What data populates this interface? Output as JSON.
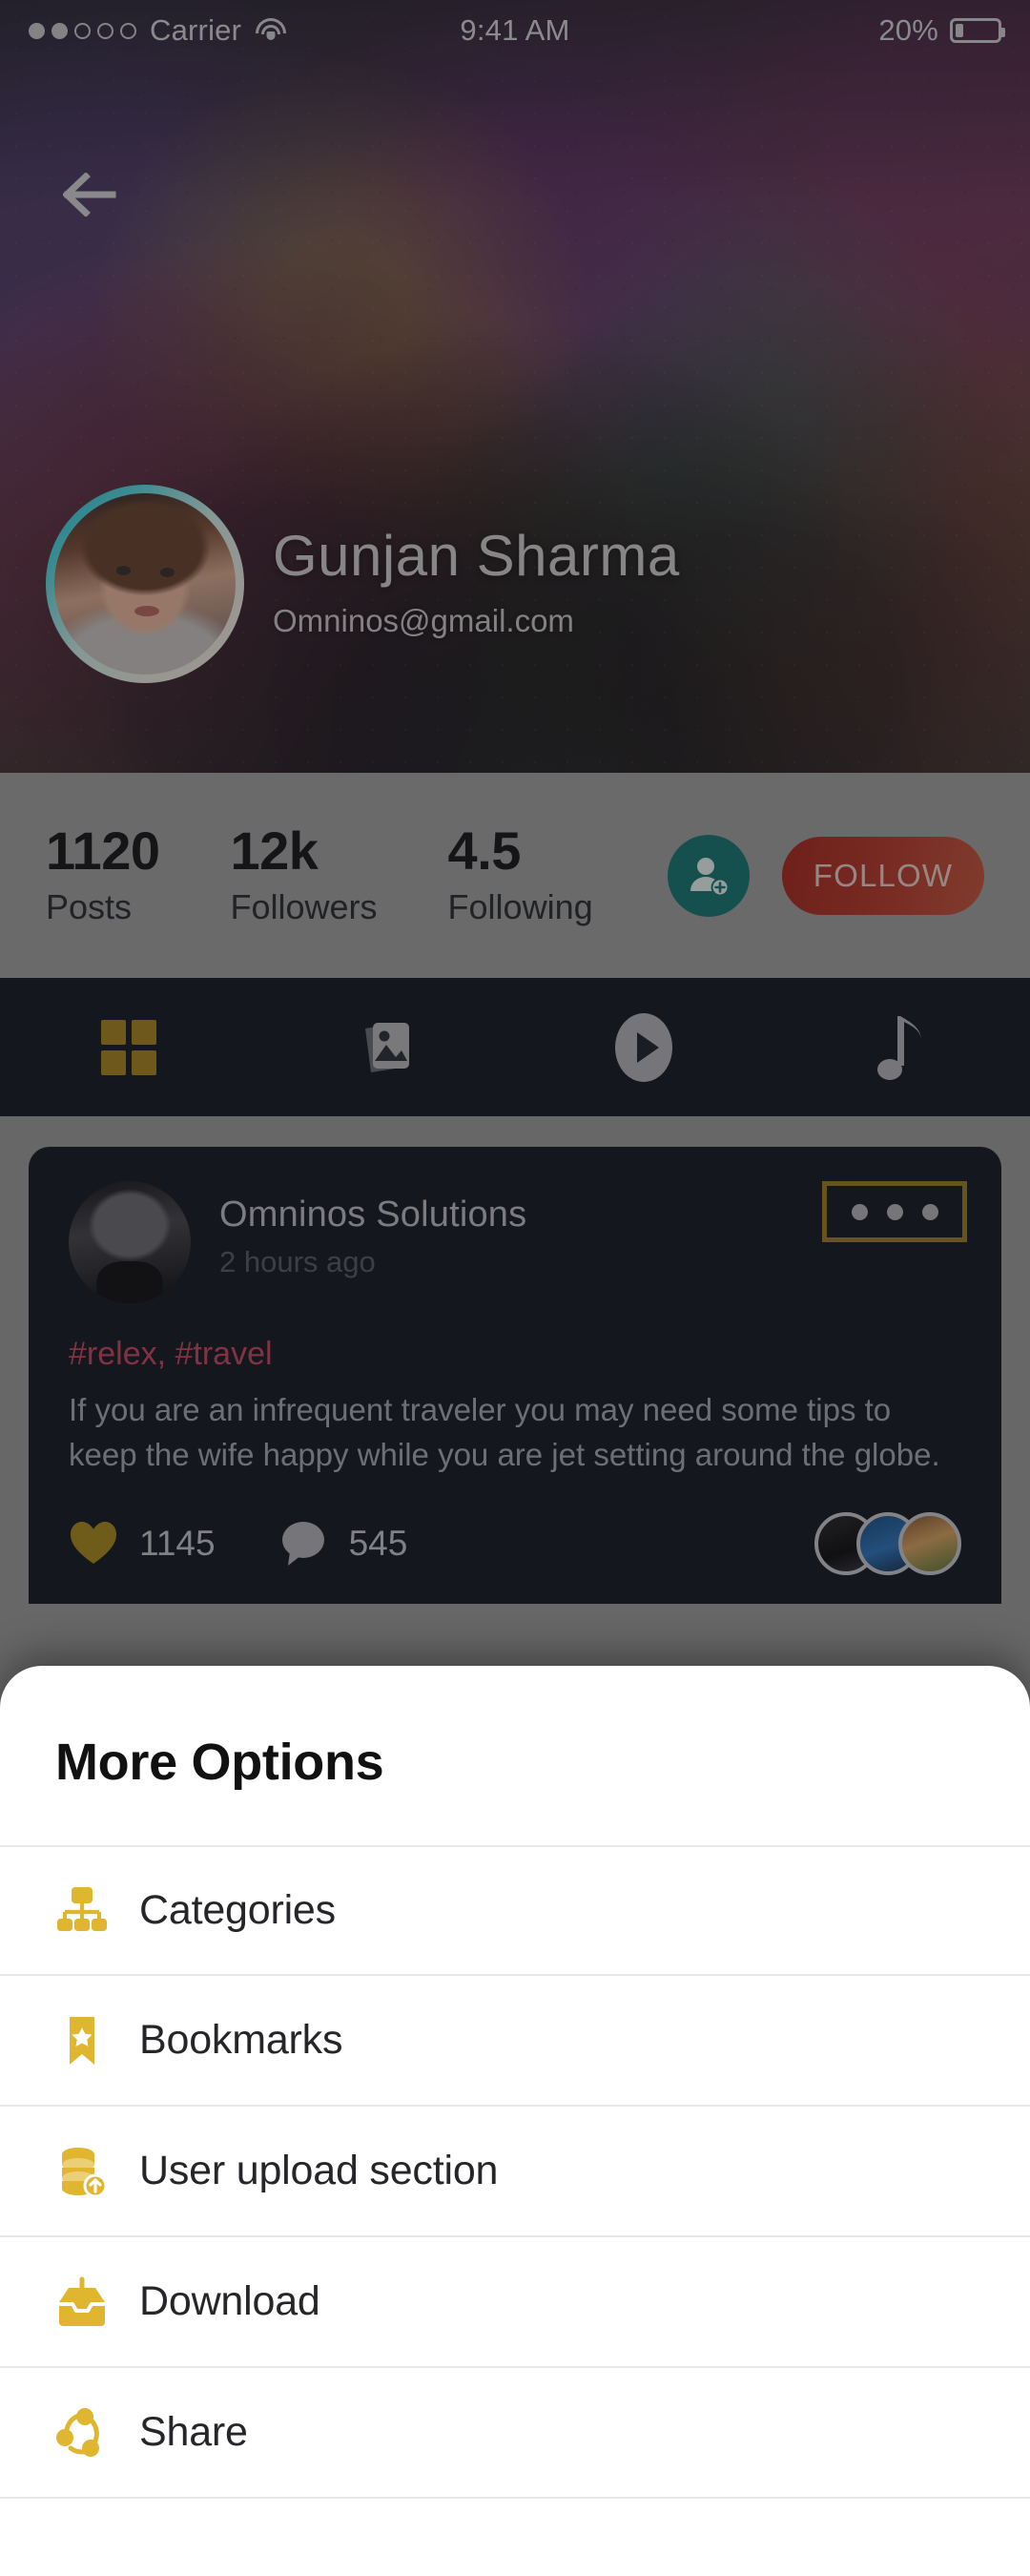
{
  "status_bar": {
    "carrier": "Carrier",
    "signal_dots_filled": 2,
    "signal_dots_total": 5,
    "wifi_icon": "wifi-icon",
    "time": "9:41 AM",
    "battery_percent": "20%",
    "battery_level": 20
  },
  "header": {
    "back_icon": "arrow-left-icon",
    "name": "Gunjan Sharma",
    "email": "Omninos@gmail.com",
    "avatar": "profile-avatar",
    "avatar_ring_color": "#35cdd8"
  },
  "stats": {
    "items": [
      {
        "value": "1120",
        "label": "Posts"
      },
      {
        "value": "12k",
        "label": "Followers"
      },
      {
        "value": "4.5",
        "label": "Following"
      }
    ],
    "add_user_icon": "add-user-icon",
    "add_user_color": "#177771",
    "follow_label": "FOLLOW",
    "follow_color": "#b03425",
    "background": "#a0a0a0"
  },
  "tabs": {
    "active_index": 0,
    "active_color": "#a8841f",
    "inactive_color": "#b4b4b8",
    "background": "#161a23",
    "items": [
      {
        "icon": "grid-icon",
        "name": "tab-grid"
      },
      {
        "icon": "photos-icon",
        "name": "tab-photos"
      },
      {
        "icon": "play-circle-icon",
        "name": "tab-videos"
      },
      {
        "icon": "music-note-icon",
        "name": "tab-music"
      }
    ]
  },
  "post": {
    "author": "Omninos Solutions",
    "timestamp": "2 hours ago",
    "avatar": "post-author-avatar",
    "more_icon": "more-horizontal-icon",
    "more_highlight_color": "#9c7d1f",
    "tags": "#relex, #travel",
    "tags_color": "#c6485e",
    "body": "If you are an infrequent traveler you may need some tips to keep the wife happy while you are jet setting around the globe.",
    "likes": "1145",
    "likes_icon": "heart-icon",
    "likes_color": "#a8891f",
    "comments": "545",
    "comments_icon": "comment-icon",
    "liker_avatars": 3,
    "card_background": "#161a23"
  },
  "sheet": {
    "title": "More Options",
    "icon_color": "#dfb githubusercontent",
    "accent": "#e0b52f",
    "items": [
      {
        "label": "Categories",
        "icon": "sitemap-icon",
        "name": "menu-item-categories"
      },
      {
        "label": "Bookmarks",
        "icon": "bookmark-star-icon",
        "name": "menu-item-bookmarks"
      },
      {
        "label": "User upload section",
        "icon": "database-upload-icon",
        "name": "menu-item-user-upload"
      },
      {
        "label": "Download",
        "icon": "download-tray-icon",
        "name": "menu-item-download"
      },
      {
        "label": "Share",
        "icon": "share-nodes-icon",
        "name": "menu-item-share"
      }
    ]
  }
}
